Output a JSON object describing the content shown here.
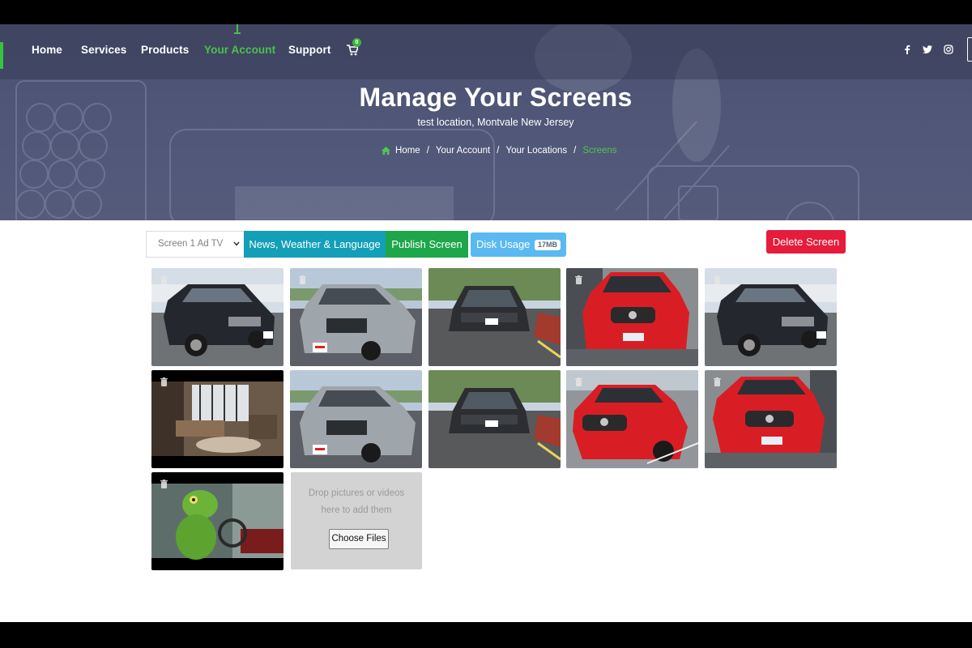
{
  "nav": {
    "items": [
      "Home",
      "Services",
      "Products",
      "Your Account",
      "Support"
    ],
    "active": "Your Account",
    "cart_count": "0",
    "social_icons": [
      "facebook-icon",
      "twitter-icon",
      "instagram-icon"
    ]
  },
  "hero": {
    "title": "Manage Your Screens",
    "subtitle": "test location, Montvale New Jersey"
  },
  "breadcrumb": {
    "items": [
      "Home",
      "Your Account",
      "Your Locations"
    ],
    "current": "Screens",
    "separator": "/"
  },
  "toolbar": {
    "screen_select": "Screen 1 Ad TV",
    "news_button": "News, Weather & Language",
    "publish_button": "Publish Screen",
    "disk_button": "Disk Usage",
    "disk_badge": "17MB",
    "delete_button": "Delete Screen"
  },
  "media": [
    "black-suv-photo",
    "silver-suv-photo",
    "dark-suv-photo",
    "red-sedan-photo",
    "black-suv-photo",
    "living-room-video",
    "silver-suv-photo",
    "dark-suv-photo",
    "red-sedan-photo",
    "red-sedan-photo",
    "gecko-video"
  ],
  "upload": {
    "drop_text": "Drop pictures or videos here to add them",
    "choose_files": "Choose Files"
  },
  "colors": {
    "accent_green": "#48c34a",
    "news_teal": "#139fb7",
    "publish_green": "#1ea64a",
    "disk_blue": "#5ab9f0",
    "delete_red": "#e51c3b"
  }
}
